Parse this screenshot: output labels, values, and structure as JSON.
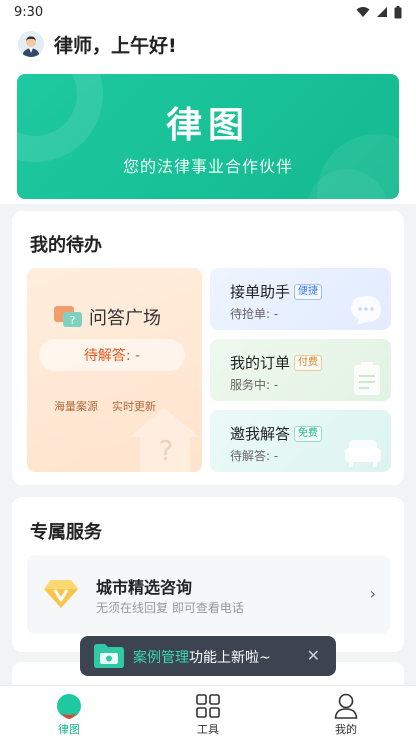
{
  "status_bar": {
    "time": "9:30"
  },
  "greeting": {
    "text": "律师，上午好!"
  },
  "banner": {
    "title": "律图",
    "subtitle": "您的法律事业合作伙伴"
  },
  "todo": {
    "title": "我的待办",
    "qa": {
      "title": "问答广场",
      "status": "待解答: -",
      "tags": [
        "海量案源",
        "实时更新"
      ]
    },
    "items": [
      {
        "title": "接单助手",
        "badge": "便捷",
        "status": "待抢单: -"
      },
      {
        "title": "我的订单",
        "badge": "付费",
        "status": "服务中: -"
      },
      {
        "title": "邀我解答",
        "badge": "免费",
        "status": "待解答: -"
      }
    ]
  },
  "service": {
    "title": "专属服务",
    "item": {
      "title": "城市精选咨询",
      "subtitle": "无须在线回复 即可查看电话"
    }
  },
  "toast": {
    "highlight": "案例管理",
    "text": "功能上新啦~"
  },
  "tabs": [
    {
      "label": "律图",
      "active": true
    },
    {
      "label": "工具",
      "active": false
    },
    {
      "label": "我的",
      "active": false
    }
  ],
  "colors": {
    "brand": "#1ec9a0",
    "accent_orange": "#e8561f",
    "toast_bg": "#3c4451"
  }
}
